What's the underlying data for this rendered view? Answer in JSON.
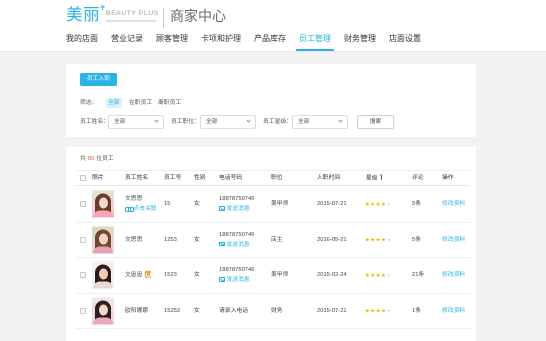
{
  "header": {
    "logo": "美丽",
    "logo_plus": "+",
    "brand_en": "BEAUTY PLUS",
    "title": "商家中心"
  },
  "nav": {
    "items": [
      {
        "label": "我的店面",
        "active": false
      },
      {
        "label": "营业记录",
        "active": false
      },
      {
        "label": "顾客管理",
        "active": false
      },
      {
        "label": "卡项和护理",
        "active": false
      },
      {
        "label": "产品库存",
        "active": false
      },
      {
        "label": "员工管理",
        "active": true
      },
      {
        "label": "财务管理",
        "active": false
      },
      {
        "label": "店面设置",
        "active": false
      }
    ]
  },
  "filter_panel": {
    "onboard_button": "员工入职",
    "filter_label": "筛选：",
    "status_options": [
      {
        "label": "全部",
        "active": true
      },
      {
        "label": "在职员工",
        "active": false
      },
      {
        "label": "离职员工",
        "active": false
      }
    ],
    "name_label": "员工姓名：",
    "name_value": "全部",
    "position_label": "员工职位：",
    "position_value": "全部",
    "star_label": "员工星级：",
    "star_value": "全部",
    "search_button": "搜索"
  },
  "list": {
    "summary_prefix": "共",
    "total": "85",
    "summary_suffix": "位员工",
    "headers": {
      "photo": "照片",
      "name": "员工姓名",
      "id": "员工号",
      "gender": "性别",
      "phone": "电话号码",
      "position": "职位",
      "hire_date": "入职时间",
      "rating": "星级",
      "comments": "评论",
      "actions": "操作"
    },
    "rating_max": 5,
    "rows": [
      {
        "name": "文思思",
        "link": "点击关联",
        "id": "15",
        "gender": "女",
        "phone": "18878750746",
        "message": "发送消息",
        "position": "美甲师",
        "hire_date": "2015-07-21",
        "rating": 4,
        "comments": "5条",
        "action": "修改资料"
      },
      {
        "name": "文思思",
        "id": "1253",
        "gender": "女",
        "phone": "18878750746",
        "message": "发送消息",
        "position": "店主",
        "hire_date": "2016-05-21",
        "rating": 4,
        "comments": "5条",
        "action": "修改资料"
      },
      {
        "name": "文思思",
        "badge_icon": "badge-icon",
        "id": "1523",
        "gender": "女",
        "phone": "18878750746",
        "message": "发送消息",
        "position": "美甲师",
        "hire_date": "2015-02-24",
        "rating": 4,
        "comments": "21条",
        "action": "修改资料"
      },
      {
        "name": "欧阳娜娜",
        "id": "15252",
        "gender": "女",
        "phone": "请录入电话",
        "position": "财务",
        "hire_date": "2015-07-21",
        "rating": 4,
        "comments": "1条",
        "action": "修改资料"
      }
    ]
  },
  "icons": {
    "dropdown": "chevron-down-icon",
    "sort": "sort-ascending-icon",
    "link": "link-icon",
    "message": "envelope-icon",
    "badge": "badge-icon",
    "star": "star-icon"
  },
  "colors": {
    "accent": "#29b3e6",
    "accent_soft": "#dcf2fb",
    "total_highlight": "#f25a3c",
    "star": "#f7b500",
    "badge": "#f5a33c"
  }
}
